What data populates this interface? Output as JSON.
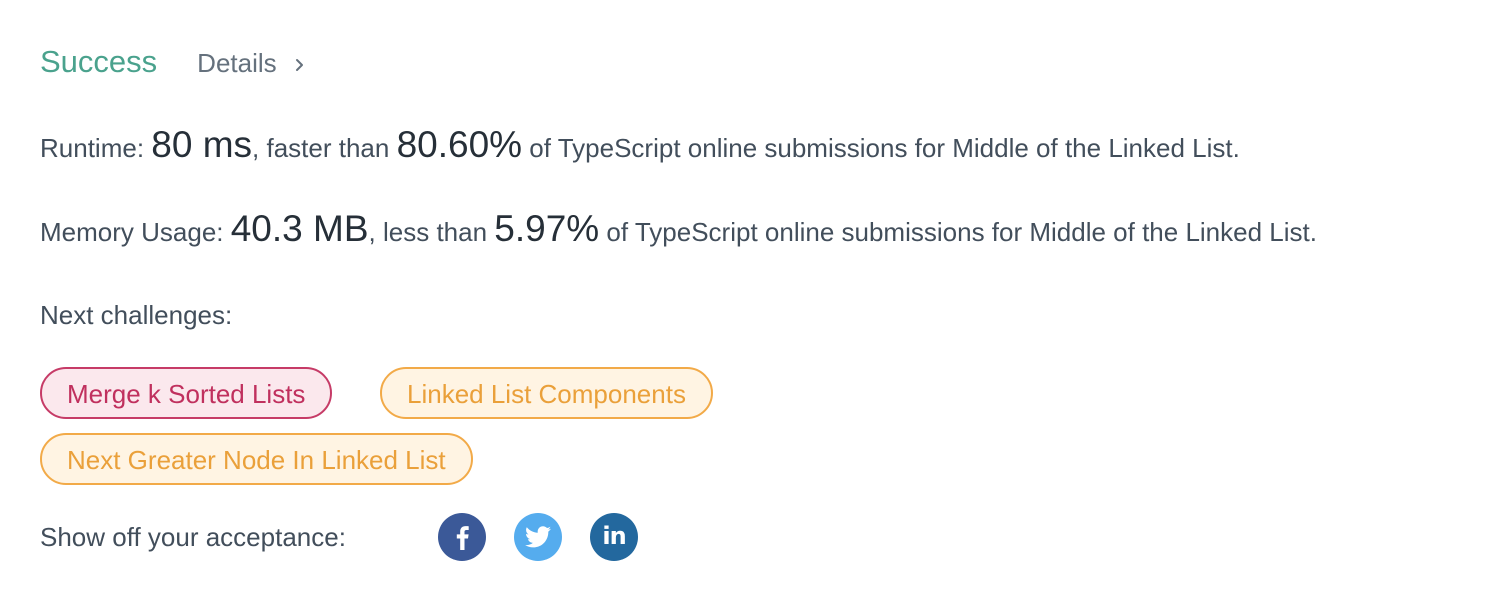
{
  "header": {
    "status": "Success",
    "details_label": "Details"
  },
  "runtime": {
    "label": "Runtime: ",
    "value": "80 ms",
    "comparison": ", faster than ",
    "percent": "80.60%",
    "suffix": " of TypeScript online submissions for Middle of the Linked List."
  },
  "memory": {
    "label": "Memory Usage: ",
    "value": "40.3 MB",
    "comparison": ", less than ",
    "percent": "5.97%",
    "suffix": " of TypeScript online submissions for Middle of the Linked List."
  },
  "next_challenges": {
    "label": "Next challenges:",
    "items": [
      {
        "label": "Merge k Sorted Lists",
        "difficulty_color": "#c63b67"
      },
      {
        "label": "Linked List Components",
        "difficulty_color": "#f2aa48"
      },
      {
        "label": "Next Greater Node In Linked List",
        "difficulty_color": "#f2aa48"
      }
    ]
  },
  "share": {
    "label": "Show off your acceptance:",
    "icons": [
      {
        "name": "facebook-icon",
        "color": "#3b5998"
      },
      {
        "name": "twitter-icon",
        "color": "#55acee"
      },
      {
        "name": "linkedin-icon",
        "color": "#23689e",
        "glyph": "in"
      }
    ]
  }
}
